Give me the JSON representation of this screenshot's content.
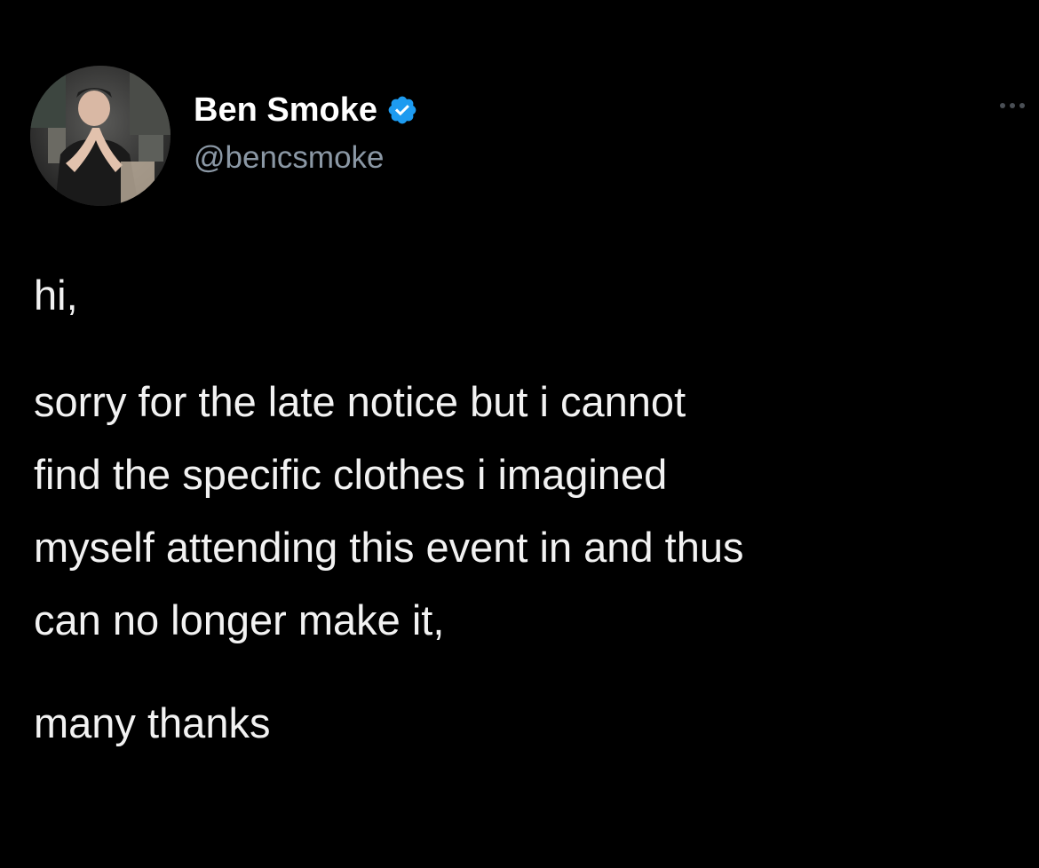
{
  "tweet": {
    "author": {
      "display_name": "Ben Smoke",
      "handle": "@bencsmoke",
      "verified": true,
      "verified_icon": "verified-badge-icon",
      "avatar_icon": "profile-photo"
    },
    "more_icon": "more-options-icon",
    "text": {
      "greeting": "hi,",
      "lines": [
        "sorry for the late notice but i cannot",
        "find the specific clothes i imagined",
        "myself attending this event in and thus",
        "can no longer make it,"
      ],
      "signoff": "many thanks"
    }
  },
  "colors": {
    "background": "#000000",
    "text": "#f2f2f2",
    "handle": "#8b98a5",
    "verified": "#1d9bf0"
  }
}
